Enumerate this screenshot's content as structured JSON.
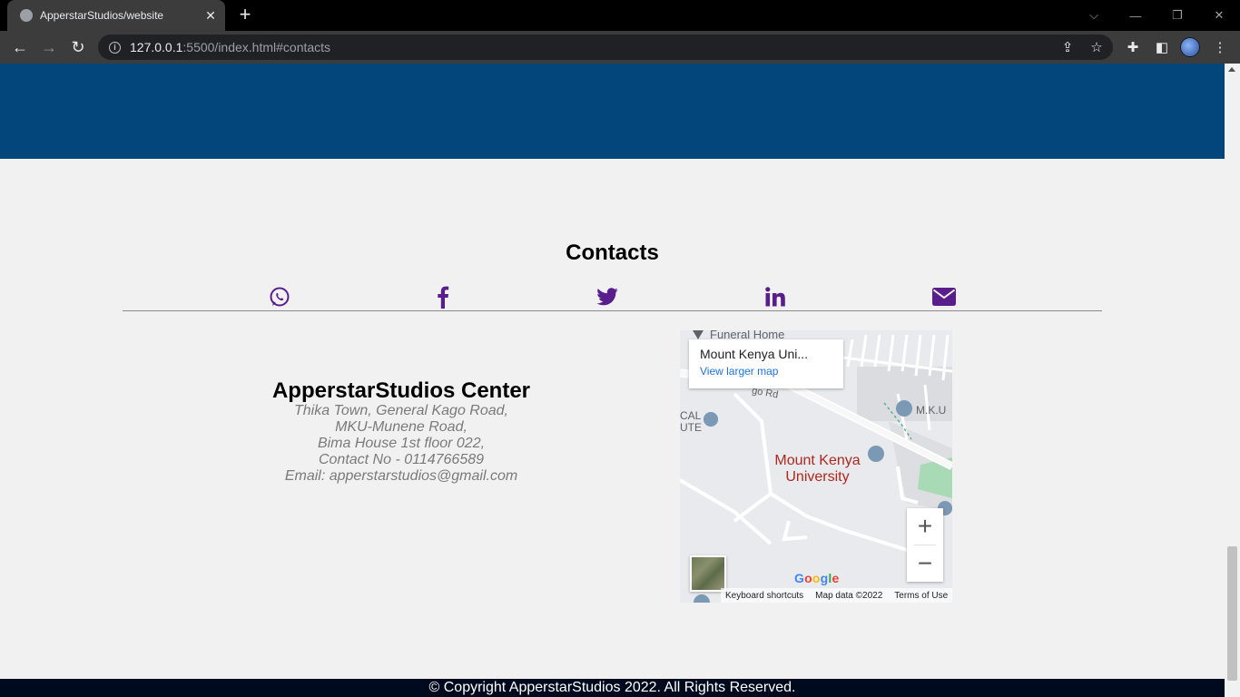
{
  "browser": {
    "tab_title": "ApperstarStudios/website",
    "tab_close": "✕",
    "new_tab": "+",
    "url_host": "127.0.0.1",
    "url_rest": ":5500/index.html#contacts"
  },
  "page": {
    "contacts_title": "Contacts",
    "social": [
      "whatsapp-icon",
      "facebook-icon",
      "twitter-icon",
      "linkedin-icon",
      "envelope-icon"
    ],
    "social_color": "#5a1e8c",
    "band_color": "#02467c",
    "center_name": "ApperstarStudios Center",
    "address_lines": [
      "Thika Town, General Kago Road,",
      "MKU-Munene Road,",
      "Bima House 1st floor 022,",
      "Contact No - 0114766589",
      "Email: apperstarstudios@gmail.com"
    ]
  },
  "map": {
    "card_place": "Mount Kenya Uni...",
    "card_link": "View larger map",
    "label_funeral": "Funeral Home",
    "label_road": "go Rd",
    "label_cal": "CAL",
    "label_ute": "UTE",
    "label_mku": "M.K.U",
    "university_line1": "Mount Kenya",
    "university_line2": "University",
    "zoom_in": "+",
    "zoom_out": "−",
    "google": "Google",
    "footer_shortcuts": "Keyboard shortcuts",
    "footer_data": "Map data ©2022",
    "footer_terms": "Terms of Use"
  },
  "footer": {
    "copyright": "© Copyright ApperstarStudios 2022. All Rights Reserved."
  }
}
